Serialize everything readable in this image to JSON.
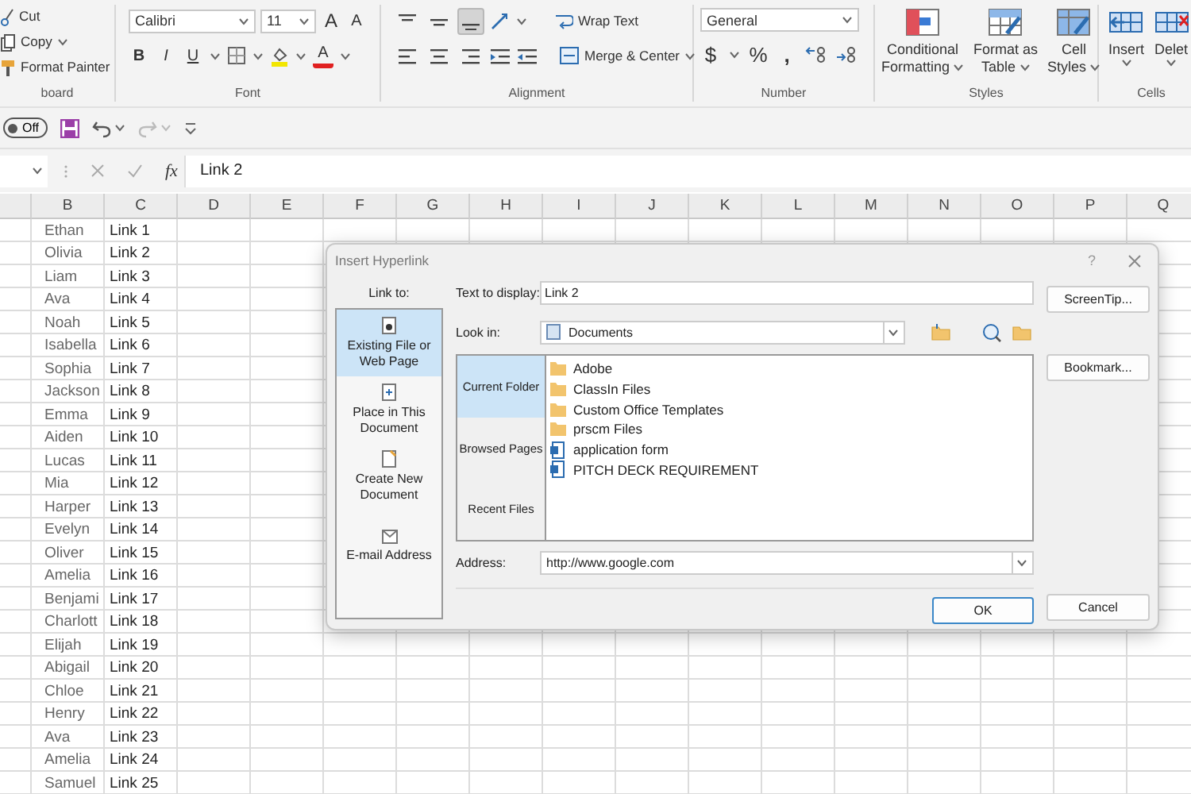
{
  "ribbon": {
    "clipboard": {
      "items": [
        {
          "kind": "cut",
          "label": "Cut"
        },
        {
          "kind": "copy",
          "label": "Copy"
        },
        {
          "kind": "painter",
          "label": "Format Painter"
        }
      ],
      "group_label": "board"
    },
    "font": {
      "font_name": "Calibri",
      "font_size": "11",
      "grow": "A",
      "shrink": "A",
      "buttons": [
        {
          "kind": "bold",
          "label": "B"
        },
        {
          "kind": "italic",
          "label": "I"
        },
        {
          "kind": "underline",
          "label": "U"
        }
      ],
      "font_color": "A",
      "group_label": "Font"
    },
    "alignment": {
      "vertical": [
        {
          "kind": "top",
          "selected": false
        },
        {
          "kind": "middle",
          "selected": false
        },
        {
          "kind": "bottom",
          "selected": true
        }
      ],
      "wrap_text": "Wrap Text",
      "merge": "Merge & Center",
      "group_label": "Alignment"
    },
    "number": {
      "format": "General",
      "symbols": [
        "$",
        "%",
        ","
      ],
      "group_label": "Number"
    },
    "styles": {
      "buttons": [
        {
          "kind": "conditional",
          "line1": "Conditional",
          "line2": "Formatting"
        },
        {
          "kind": "table",
          "line1": "Format as",
          "line2": "Table"
        },
        {
          "kind": "cell",
          "line1": "Cell",
          "line2": "Styles"
        }
      ],
      "group_label": "Styles"
    },
    "cells": {
      "buttons": [
        {
          "kind": "insert",
          "label": "Insert"
        },
        {
          "kind": "delete",
          "label": "Delet"
        }
      ],
      "group_label": "Cells"
    }
  },
  "quick_access": {
    "autosave": {
      "label": "Off",
      "on": false
    }
  },
  "formula_bar": {
    "function_label": "fx",
    "value": "Link 2"
  },
  "sheet": {
    "columns": [
      "B",
      "C",
      "D",
      "E",
      "F",
      "G",
      "H",
      "I",
      "J",
      "K",
      "L",
      "M",
      "N",
      "O",
      "P",
      "Q"
    ],
    "rows": [
      [
        "Ethan",
        "Link 1"
      ],
      [
        "Olivia",
        "Link 2"
      ],
      [
        "Liam",
        "Link 3"
      ],
      [
        "Ava",
        "Link 4"
      ],
      [
        "Noah",
        "Link 5"
      ],
      [
        "Isabella",
        "Link 6"
      ],
      [
        "Sophia",
        "Link 7"
      ],
      [
        "Jackson",
        "Link 8"
      ],
      [
        "Emma",
        "Link 9"
      ],
      [
        "Aiden",
        "Link 10"
      ],
      [
        "Lucas",
        "Link 11"
      ],
      [
        "Mia",
        "Link 12"
      ],
      [
        "Harper",
        "Link 13"
      ],
      [
        "Evelyn",
        "Link 14"
      ],
      [
        "Oliver",
        "Link 15"
      ],
      [
        "Amelia",
        "Link 16"
      ],
      [
        "Benjami",
        "Link 17"
      ],
      [
        "Charlott",
        "Link 18"
      ],
      [
        "Elijah",
        "Link 19"
      ],
      [
        "Abigail",
        "Link 20"
      ],
      [
        "Chloe",
        "Link 21"
      ],
      [
        "Henry",
        "Link 22"
      ],
      [
        "Ava",
        "Link 23"
      ],
      [
        "Amelia",
        "Link 24"
      ],
      [
        "Samuel",
        "Link 25"
      ]
    ]
  },
  "dialog": {
    "title": "Insert Hyperlink",
    "help": "?",
    "link_to_label": "Link to:",
    "link_to": [
      {
        "kind": "existing",
        "label": "Existing File or Web Page",
        "selected": true
      },
      {
        "kind": "place",
        "label": "Place in This Document",
        "selected": false
      },
      {
        "kind": "new",
        "label": "Create New Document",
        "selected": false
      },
      {
        "kind": "email",
        "label": "E-mail Address",
        "selected": false
      }
    ],
    "text_to_display_label": "Text to display:",
    "text_to_display": "Link 2",
    "screentip": "ScreenTip...",
    "look_in_label": "Look in:",
    "look_in": "Documents",
    "views": [
      {
        "label": "Current Folder",
        "selected": true
      },
      {
        "label": "Browsed Pages",
        "selected": false
      },
      {
        "label": "Recent Files",
        "selected": false
      }
    ],
    "files": [
      {
        "kind": "folder",
        "name": "Adobe"
      },
      {
        "kind": "folder",
        "name": "ClassIn Files"
      },
      {
        "kind": "folder",
        "name": "Custom Office Templates"
      },
      {
        "kind": "folder",
        "name": "prscm Files"
      },
      {
        "kind": "document",
        "name": "application form"
      },
      {
        "kind": "document",
        "name": "PITCH DECK REQUIREMENT"
      }
    ],
    "bookmark": "Bookmark...",
    "address_label": "Address:",
    "address": "http://www.google.com",
    "ok": "OK",
    "cancel": "Cancel"
  }
}
